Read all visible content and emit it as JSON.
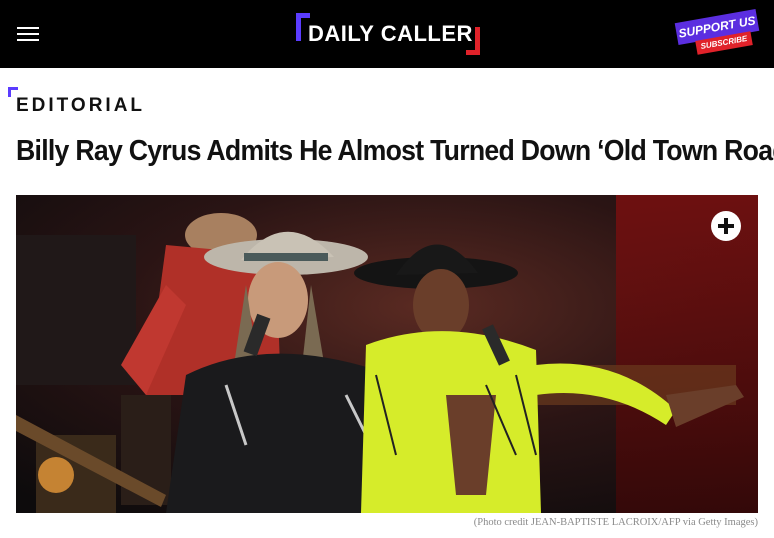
{
  "header": {
    "menu_icon": "hamburger-menu-icon",
    "logo_text": "DAILY CALLER",
    "support": {
      "line1": "SUPPORT US",
      "line2": "SUBSCRIBE"
    },
    "colors": {
      "background": "#000000",
      "brand_purple": "#5b3cff",
      "brand_red": "#e0222a"
    }
  },
  "article": {
    "category": "EDITORIAL",
    "headline": "Billy Ray Cyrus Admits He Almost Turned Down ‘Old Town Road’",
    "image": {
      "expand_icon": "plus-circle-icon",
      "credit": "(Photo credit JEAN-BAPTISTE LACROIX/AFP via Getty Images)"
    }
  }
}
